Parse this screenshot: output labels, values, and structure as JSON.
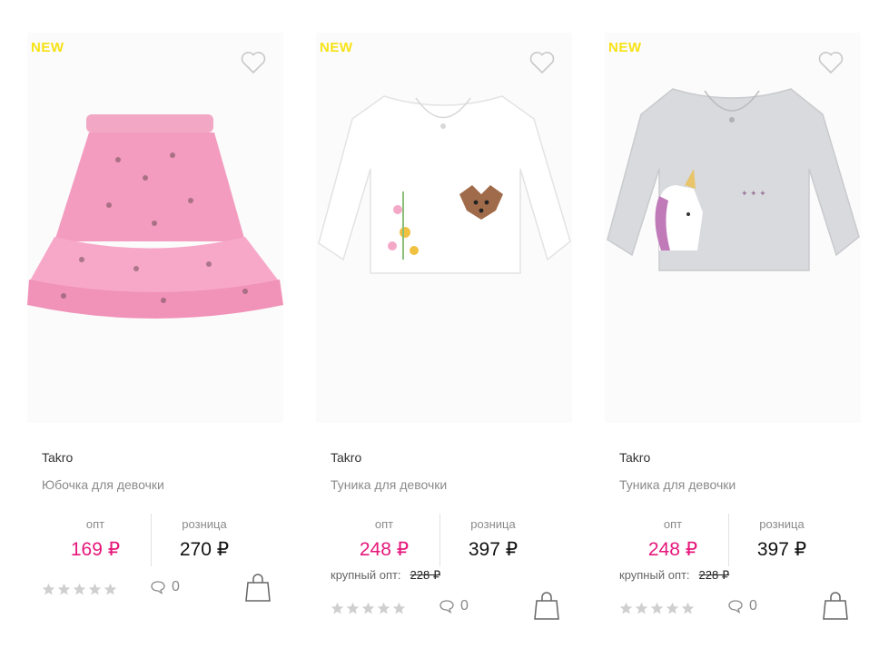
{
  "products": [
    {
      "badge": "NEW",
      "brand": "Takro",
      "name": "Юбочка для девочки",
      "opt_label": "опт",
      "retail_label": "розница",
      "opt_price": "169 ₽",
      "retail_price": "270 ₽",
      "bulk_label": "",
      "bulk_price": "",
      "rating": 0,
      "comments": "0",
      "image": "pink-floral-skirt",
      "accent": "#e5177b"
    },
    {
      "badge": "NEW",
      "brand": "Takro",
      "name": "Туника для девочки",
      "opt_label": "опт",
      "retail_label": "розница",
      "opt_price": "248 ₽",
      "retail_price": "397 ₽",
      "bulk_label": "крупный опт:",
      "bulk_price": "228 ₽",
      "rating": 0,
      "comments": "0",
      "image": "white-tunic-with-fawn",
      "accent": "#e5177b"
    },
    {
      "badge": "NEW",
      "brand": "Takro",
      "name": "Туника для девочки",
      "opt_label": "опт",
      "retail_label": "розница",
      "opt_price": "248 ₽",
      "retail_price": "397 ₽",
      "bulk_label": "крупный опт:",
      "bulk_price": "228 ₽",
      "rating": 0,
      "comments": "0",
      "image": "grey-tunic-with-unicorn",
      "accent": "#e5177b"
    }
  ],
  "icons": {
    "favorite": "heart-outline-icon",
    "star": "star-icon",
    "comment": "speech-bubble-icon",
    "cart": "shopping-bag-icon"
  },
  "colors": {
    "badge": "#f7e214",
    "opt_price": "#e5177b",
    "star_empty": "#cfcfcf"
  }
}
